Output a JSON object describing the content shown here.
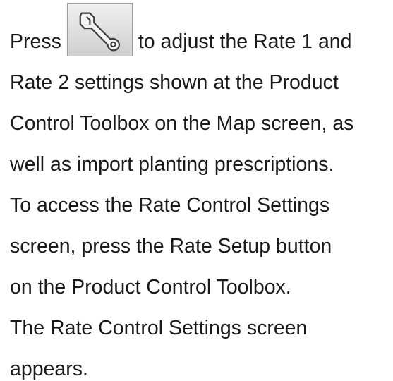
{
  "paragraph1": {
    "line1_before": "Press",
    "line1_after": "to adjust the Rate 1 and",
    "line2": "Rate 2 settings shown at the Product",
    "line3": "Control Toolbox on the Map screen, as",
    "line4": "well as import planting prescriptions.",
    "line5": "To access the Rate Control Settings",
    "line6": "screen, press the Rate Setup button",
    "line7": "on the Product Control Toolbox."
  },
  "paragraph2": {
    "line1": "The Rate Control Settings screen",
    "line2": "appears."
  },
  "icons": {
    "settings_button_icon": "wrench-icon"
  }
}
